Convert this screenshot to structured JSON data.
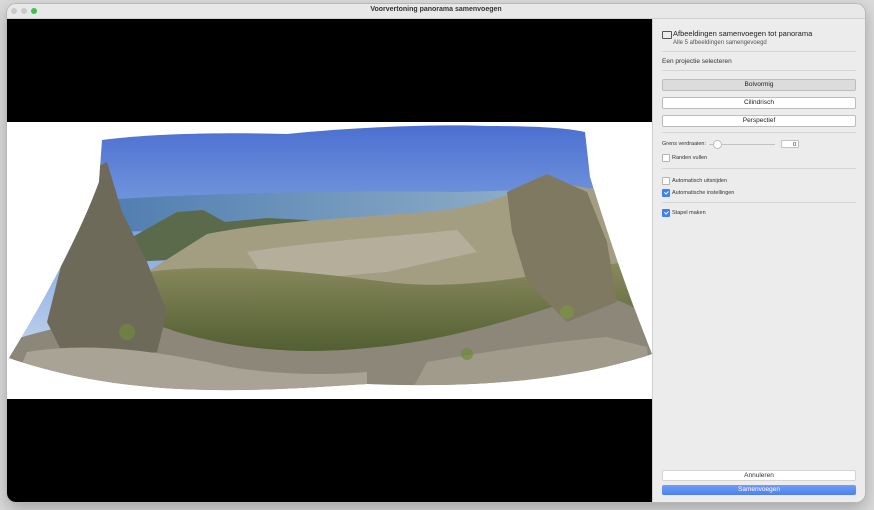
{
  "window": {
    "title": "Voorvertoning panorama samenvoegen"
  },
  "sidebar": {
    "header_title": "Afbeeldingen samenvoegen tot panorama",
    "header_subtitle": "Alle 5 afbeeldingen samengevoegd",
    "projection_label": "Een projectie selecteren",
    "projections": [
      {
        "label": "Bolvormig",
        "selected": true
      },
      {
        "label": "Cilindrisch",
        "selected": false
      },
      {
        "label": "Perspectief",
        "selected": false
      }
    ],
    "boundary_warp_label": "Grens verdraaien:",
    "boundary_warp_value": "0",
    "fill_edges_label": "Randen vullen",
    "fill_edges_checked": false,
    "auto_crop_label": "Automatisch uitsnijden",
    "auto_crop_checked": false,
    "auto_settings_label": "Automatische instellingen",
    "auto_settings_checked": true,
    "create_stack_label": "Stapel maken",
    "create_stack_checked": true,
    "cancel_label": "Annuleren",
    "merge_label": "Samenvoegen"
  },
  "colors": {
    "accent": "#4d7ff0",
    "traffic_max": "#3fc14b"
  }
}
